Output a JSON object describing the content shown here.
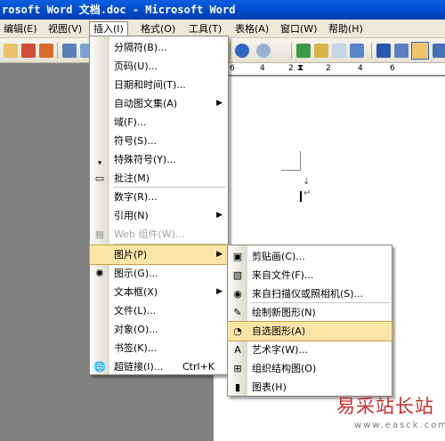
{
  "window": {
    "title": "rosoft Word 文档.doc - Microsoft Word"
  },
  "menubar": [
    {
      "label": "编辑(E)",
      "open": false
    },
    {
      "label": "视图(V)",
      "open": false
    },
    {
      "label": "插入(I)",
      "open": true
    },
    {
      "label": "格式(O)",
      "open": false
    },
    {
      "label": "工具(T)",
      "open": false
    },
    {
      "label": "表格(A)",
      "open": false
    },
    {
      "label": "窗口(W)",
      "open": false
    },
    {
      "label": "帮助(H)",
      "open": false
    }
  ],
  "ruler": {
    "marks": [
      "6",
      "4",
      "2",
      "2",
      "4",
      "6"
    ]
  },
  "document": {
    "cursor_mark": "↵"
  },
  "insert_menu": {
    "items": [
      {
        "label": "分隔符(B)...",
        "icon": "",
        "arrow": "",
        "shortcut": "",
        "disabled": false,
        "highlighted": false
      },
      {
        "label": "页码(U)...",
        "icon": "",
        "arrow": "",
        "shortcut": "",
        "disabled": false,
        "highlighted": false
      },
      {
        "label": "日期和时间(T)...",
        "icon": "",
        "arrow": "",
        "shortcut": "",
        "disabled": false,
        "highlighted": false
      },
      {
        "label": "自动图文集(A)",
        "icon": "",
        "arrow": "▶",
        "shortcut": "",
        "disabled": false,
        "highlighted": false
      },
      {
        "label": "域(F)...",
        "icon": "",
        "arrow": "",
        "shortcut": "",
        "disabled": false,
        "highlighted": false
      },
      {
        "label": "符号(S)...",
        "icon": "",
        "arrow": "",
        "shortcut": "",
        "disabled": false,
        "highlighted": false
      },
      {
        "label": "特殊符号(Y)...",
        "icon": "❟",
        "arrow": "",
        "shortcut": "",
        "disabled": false,
        "highlighted": false
      },
      {
        "label": "批注(M)",
        "icon": "▭",
        "arrow": "",
        "shortcut": "",
        "disabled": false,
        "highlighted": false
      },
      {
        "label": "数字(R)...",
        "icon": "",
        "arrow": "",
        "shortcut": "",
        "disabled": false,
        "highlighted": false
      },
      {
        "label": "引用(N)",
        "icon": "",
        "arrow": "▶",
        "shortcut": "",
        "disabled": false,
        "highlighted": false
      },
      {
        "label": "Web 组件(W)...",
        "icon": "▦",
        "arrow": "",
        "shortcut": "",
        "disabled": true,
        "highlighted": false
      },
      {
        "label": "图片(P)",
        "icon": "",
        "arrow": "▶",
        "shortcut": "",
        "disabled": false,
        "highlighted": true
      },
      {
        "label": "图示(G)...",
        "icon": "✺",
        "arrow": "",
        "shortcut": "",
        "disabled": false,
        "highlighted": false
      },
      {
        "label": "文本框(X)",
        "icon": "",
        "arrow": "▶",
        "shortcut": "",
        "disabled": false,
        "highlighted": false
      },
      {
        "label": "文件(L)...",
        "icon": "",
        "arrow": "",
        "shortcut": "",
        "disabled": false,
        "highlighted": false
      },
      {
        "label": "对象(O)...",
        "icon": "",
        "arrow": "",
        "shortcut": "",
        "disabled": false,
        "highlighted": false
      },
      {
        "label": "书签(K)...",
        "icon": "",
        "arrow": "",
        "shortcut": "",
        "disabled": false,
        "highlighted": false
      },
      {
        "label": "超链接(I)...",
        "icon": "🌐",
        "arrow": "",
        "shortcut": "Ctrl+K",
        "disabled": false,
        "highlighted": false
      }
    ]
  },
  "picture_submenu": {
    "items": [
      {
        "label": "剪贴画(C)...",
        "icon": "▣",
        "highlighted": false
      },
      {
        "label": "来自文件(F)...",
        "icon": "▧",
        "highlighted": false
      },
      {
        "label": "来自扫描仪或照相机(S)...",
        "icon": "◉",
        "highlighted": false
      },
      {
        "label": "绘制新图形(N)",
        "icon": "✎",
        "highlighted": false
      },
      {
        "label": "自选图形(A)",
        "icon": "◔",
        "highlighted": true
      },
      {
        "label": "艺术字(W)...",
        "icon": "A",
        "highlighted": false
      },
      {
        "label": "组织结构图(O)",
        "icon": "⊞",
        "highlighted": false
      },
      {
        "label": "图表(H)",
        "icon": "▮",
        "highlighted": false
      }
    ]
  },
  "watermark": {
    "title": "易采站长站",
    "url": "www.easck.com"
  }
}
